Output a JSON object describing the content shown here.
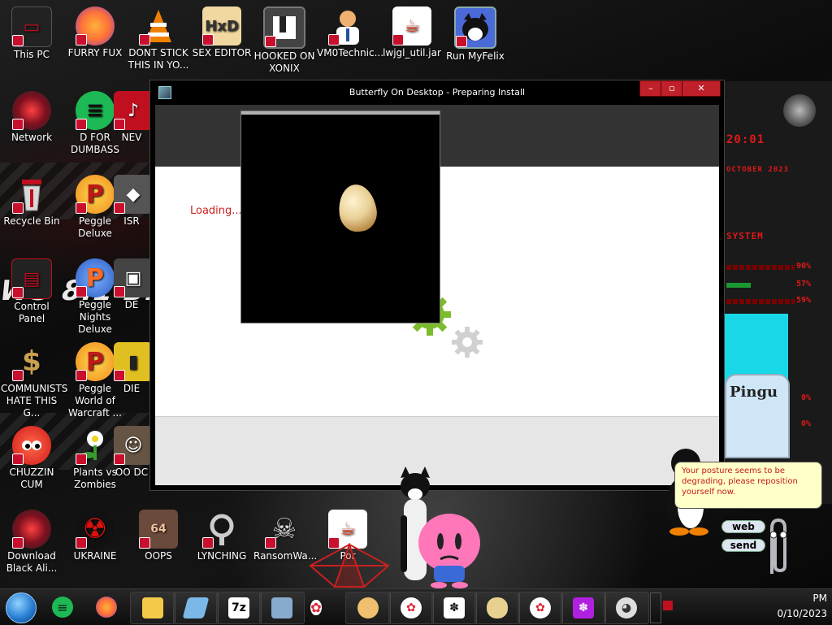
{
  "desktop_icons": [
    {
      "label": "This PC",
      "icon": "computer-icon",
      "color": "#c01020"
    },
    {
      "label": "FURRY FUX",
      "icon": "firefox-icon",
      "color": "#ff7139"
    },
    {
      "label": "DONT STICK THIS IN YO...",
      "icon": "vlc-cone-icon",
      "color": "#f08000"
    },
    {
      "label": "SEX EDITOR",
      "icon": "hxd-editor-icon",
      "color": "#e8a030"
    },
    {
      "label": "HOOKED ON XONIX",
      "icon": "game-icon",
      "color": "#3a3a3a"
    },
    {
      "label": "VM0Technic...",
      "icon": "person-icon",
      "color": "#f0b070"
    },
    {
      "label": "lwjgl_util.jar",
      "icon": "java-icon",
      "color": "#e04020"
    },
    {
      "label": "Run MyFelix",
      "icon": "cat-icon",
      "color": "#ffffff"
    },
    {
      "label": "Network",
      "icon": "alienware-orb-icon",
      "color": "#c01020"
    },
    {
      "label": "D FOR DUMBASS",
      "icon": "spotify-icon",
      "color": "#1db954"
    },
    {
      "label": "NEV",
      "icon": "app-icon",
      "color": "#c01020"
    },
    {
      "label": "Recycle Bin",
      "icon": "recycle-bin-icon",
      "color": "#c01020"
    },
    {
      "label": "Peggle Deluxe",
      "icon": "peggle-icon",
      "color": "#e8402a"
    },
    {
      "label": "ISR",
      "icon": "app-icon",
      "color": "#999999"
    },
    {
      "label": "Control Panel",
      "icon": "control-panel-icon",
      "color": "#c01020"
    },
    {
      "label": "Peggle Nights Deluxe",
      "icon": "peggle-icon",
      "color": "#3a78d0"
    },
    {
      "label": "DE",
      "icon": "app-icon",
      "color": "#999999"
    },
    {
      "label": "COMMUNISTS HATE THIS G...",
      "icon": "money-bag-icon",
      "color": "#c8a050"
    },
    {
      "label": "Peggle World of Warcraft ...",
      "icon": "peggle-icon",
      "color": "#e8402a"
    },
    {
      "label": "DIE",
      "icon": "app-icon",
      "color": "#e0c020"
    },
    {
      "label": "CHUZZIN CUM",
      "icon": "chuzzle-icon",
      "color": "#e82020"
    },
    {
      "label": "Plants vs Zombies",
      "icon": "flower-icon",
      "color": "#ffffff"
    },
    {
      "label": "OO DC",
      "icon": "app-icon",
      "color": "#999999"
    },
    {
      "label": "Download Black Ali...",
      "icon": "alienware-orb-icon",
      "color": "#c01020"
    },
    {
      "label": "UKRAINE",
      "icon": "radiation-icon",
      "color": "#e01010"
    },
    {
      "label": "OOPS",
      "icon": "portrait-icon",
      "color": "#c08060"
    },
    {
      "label": "LYNCHING",
      "icon": "rope-icon",
      "color": "#cccccc"
    },
    {
      "label": "RansomWa...",
      "icon": "skull-icon",
      "color": "#dddddd"
    },
    {
      "label": "Por",
      "icon": "java-icon",
      "color": "#e04020"
    }
  ],
  "wallpaper": {
    "logo_text": "WS 8.1 BLAC"
  },
  "window": {
    "title": "Butterfly On Desktop - Preparing Install",
    "loading_text": "Loading..."
  },
  "assistant": {
    "message": "Your posture seems to be degrading, please reposition yourself now.",
    "web_label": "web",
    "send_label": "send"
  },
  "widget": {
    "time": "20:01",
    "date": "OCTOBER 2023",
    "section": "SYSTEM",
    "rows": [
      "90%",
      "57%",
      "59%",
      "0%",
      "0%"
    ],
    "card_label": "Pingu"
  },
  "taskbar": {
    "apps": [
      {
        "name": "spotify-icon",
        "color": "#1db954"
      },
      {
        "name": "firefox-icon",
        "color": "#ff7139"
      },
      {
        "name": "file-explorer-icon",
        "color": "#f3c94a"
      },
      {
        "name": "notepad-icon",
        "color": "#7ab8e8"
      },
      {
        "name": "7zip-icon",
        "color": "#ffffff"
      },
      {
        "name": "media-icon",
        "color": "#88aacc"
      },
      {
        "name": "hello-kitty-icon",
        "color": "#ffffff"
      },
      {
        "name": "character-icon",
        "color": "#f0c070"
      },
      {
        "name": "hello-kitty-icon",
        "color": "#ffffff"
      },
      {
        "name": "paw-icon",
        "color": "#ffffff"
      },
      {
        "name": "bread-icon",
        "color": "#e8d090"
      },
      {
        "name": "hello-kitty-icon",
        "color": "#ffffff"
      },
      {
        "name": "paw-purple-icon",
        "color": "#b020e0"
      },
      {
        "name": "mouse-icon",
        "color": "#dddddd"
      }
    ],
    "clock_time": "PM",
    "clock_date": "0/10/2023"
  }
}
